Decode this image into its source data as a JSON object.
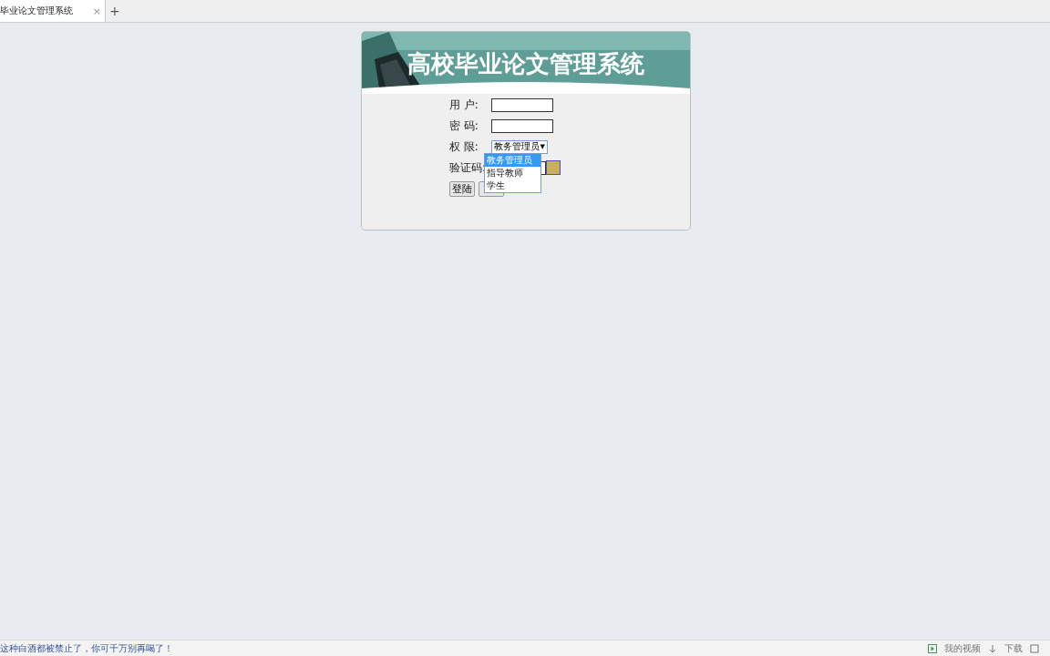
{
  "browser_tab": {
    "title": "毕业论文管理系统",
    "close": "×",
    "new_tab": "+"
  },
  "login": {
    "title": "高校毕业论文管理系统",
    "fields": [
      {
        "label": "用 户:"
      },
      {
        "label": "密 码:"
      }
    ],
    "role": {
      "label": "权 限:",
      "value": "教务管理员",
      "arrow": "▼",
      "expanded": true,
      "options": [
        {
          "label": "教务管理员",
          "selected": true
        },
        {
          "label": "指导教师",
          "selected": false
        },
        {
          "label": "学生",
          "selected": false
        }
      ]
    },
    "captcha": {
      "label": "验证码:"
    },
    "login_button": "登陆"
  },
  "status_bar": {
    "message": "这种白酒都被禁止了，你可千万别再喝了！",
    "video": "我的视频",
    "download": "下载"
  }
}
